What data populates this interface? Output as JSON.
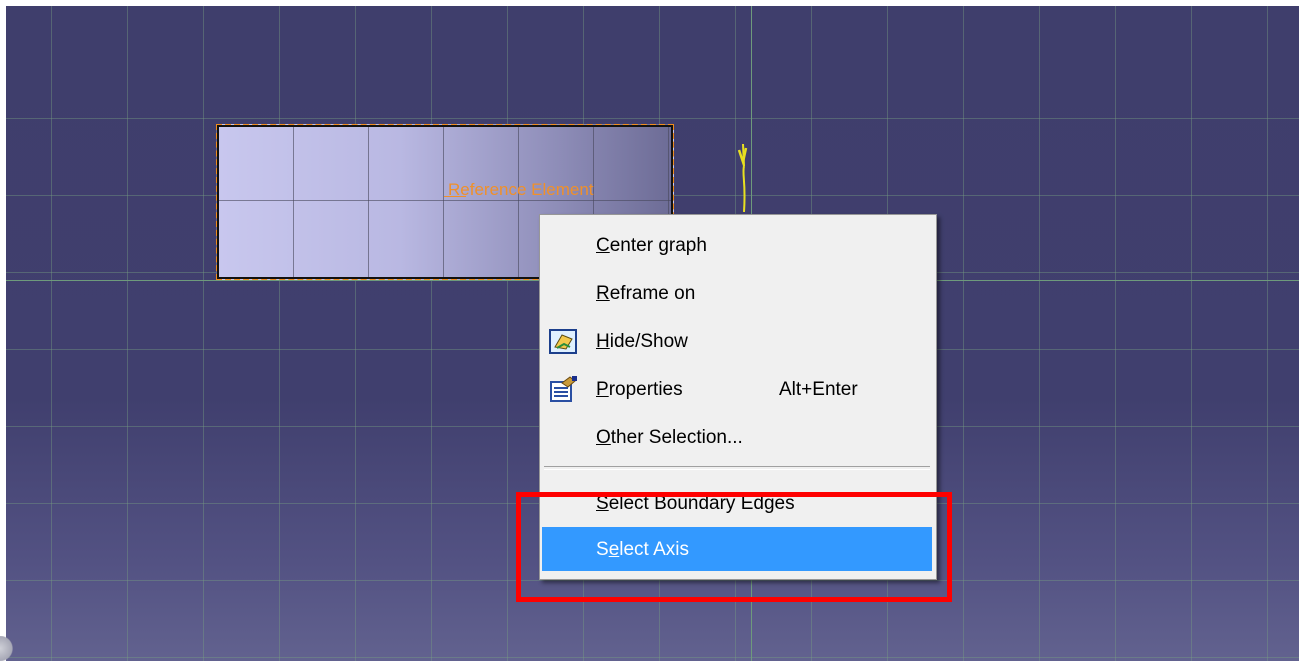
{
  "viewport": {
    "reference_label": "Reference Element",
    "axis_marker_icon": "v-axis-icon"
  },
  "context_menu": {
    "items": [
      {
        "pre": "",
        "accel": "C",
        "post": "enter graph",
        "shortcut": "",
        "icon": ""
      },
      {
        "pre": "",
        "accel": "R",
        "post": "eframe on",
        "shortcut": "",
        "icon": ""
      },
      {
        "pre": "",
        "accel": "H",
        "post": "ide/Show",
        "shortcut": "",
        "icon": "hide-show-icon"
      },
      {
        "pre": "",
        "accel": "P",
        "post": "roperties",
        "shortcut": "Alt+Enter",
        "icon": "properties-icon"
      },
      {
        "pre": "",
        "accel": "O",
        "post": "ther Selection...",
        "shortcut": "",
        "icon": ""
      },
      {
        "pre": "",
        "accel": "S",
        "post": "elect Boundary Edges",
        "shortcut": "",
        "icon": ""
      },
      {
        "pre": "S",
        "accel": "e",
        "post": "lect Axis",
        "shortcut": "",
        "icon": ""
      }
    ],
    "highlighted_index": 6,
    "highlight_color": "#3399ff"
  },
  "annotation": {
    "highlight_box_color": "#ff0000"
  }
}
